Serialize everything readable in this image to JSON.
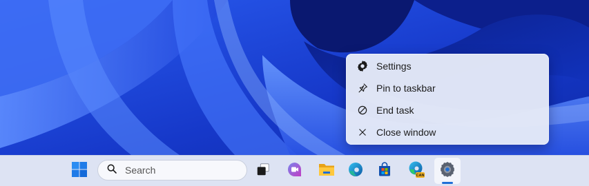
{
  "context_menu": {
    "items": [
      {
        "label": "Settings",
        "icon": "gear-icon"
      },
      {
        "label": "Pin to taskbar",
        "icon": "pin-icon"
      },
      {
        "label": "End task",
        "icon": "end-task-icon"
      },
      {
        "label": "Close window",
        "icon": "close-icon"
      }
    ]
  },
  "taskbar": {
    "search": {
      "placeholder": "Search",
      "icon": "search-icon"
    },
    "apps": [
      {
        "icon": "windows-start-icon"
      },
      {
        "icon": "task-view-icon"
      },
      {
        "icon": "teams-chat-icon"
      },
      {
        "icon": "file-explorer-icon"
      },
      {
        "icon": "edge-browser-icon"
      },
      {
        "icon": "microsoft-store-icon"
      },
      {
        "icon": "edge-canary-icon",
        "badge": "CAN"
      },
      {
        "icon": "settings-app-icon",
        "active": true
      }
    ]
  },
  "colors": {
    "accent": "#1f6fd6",
    "wallpaper_base": "#1a3fd6",
    "menu_background": "#e4e9f7",
    "taskbar_background": "#dde3f3"
  }
}
